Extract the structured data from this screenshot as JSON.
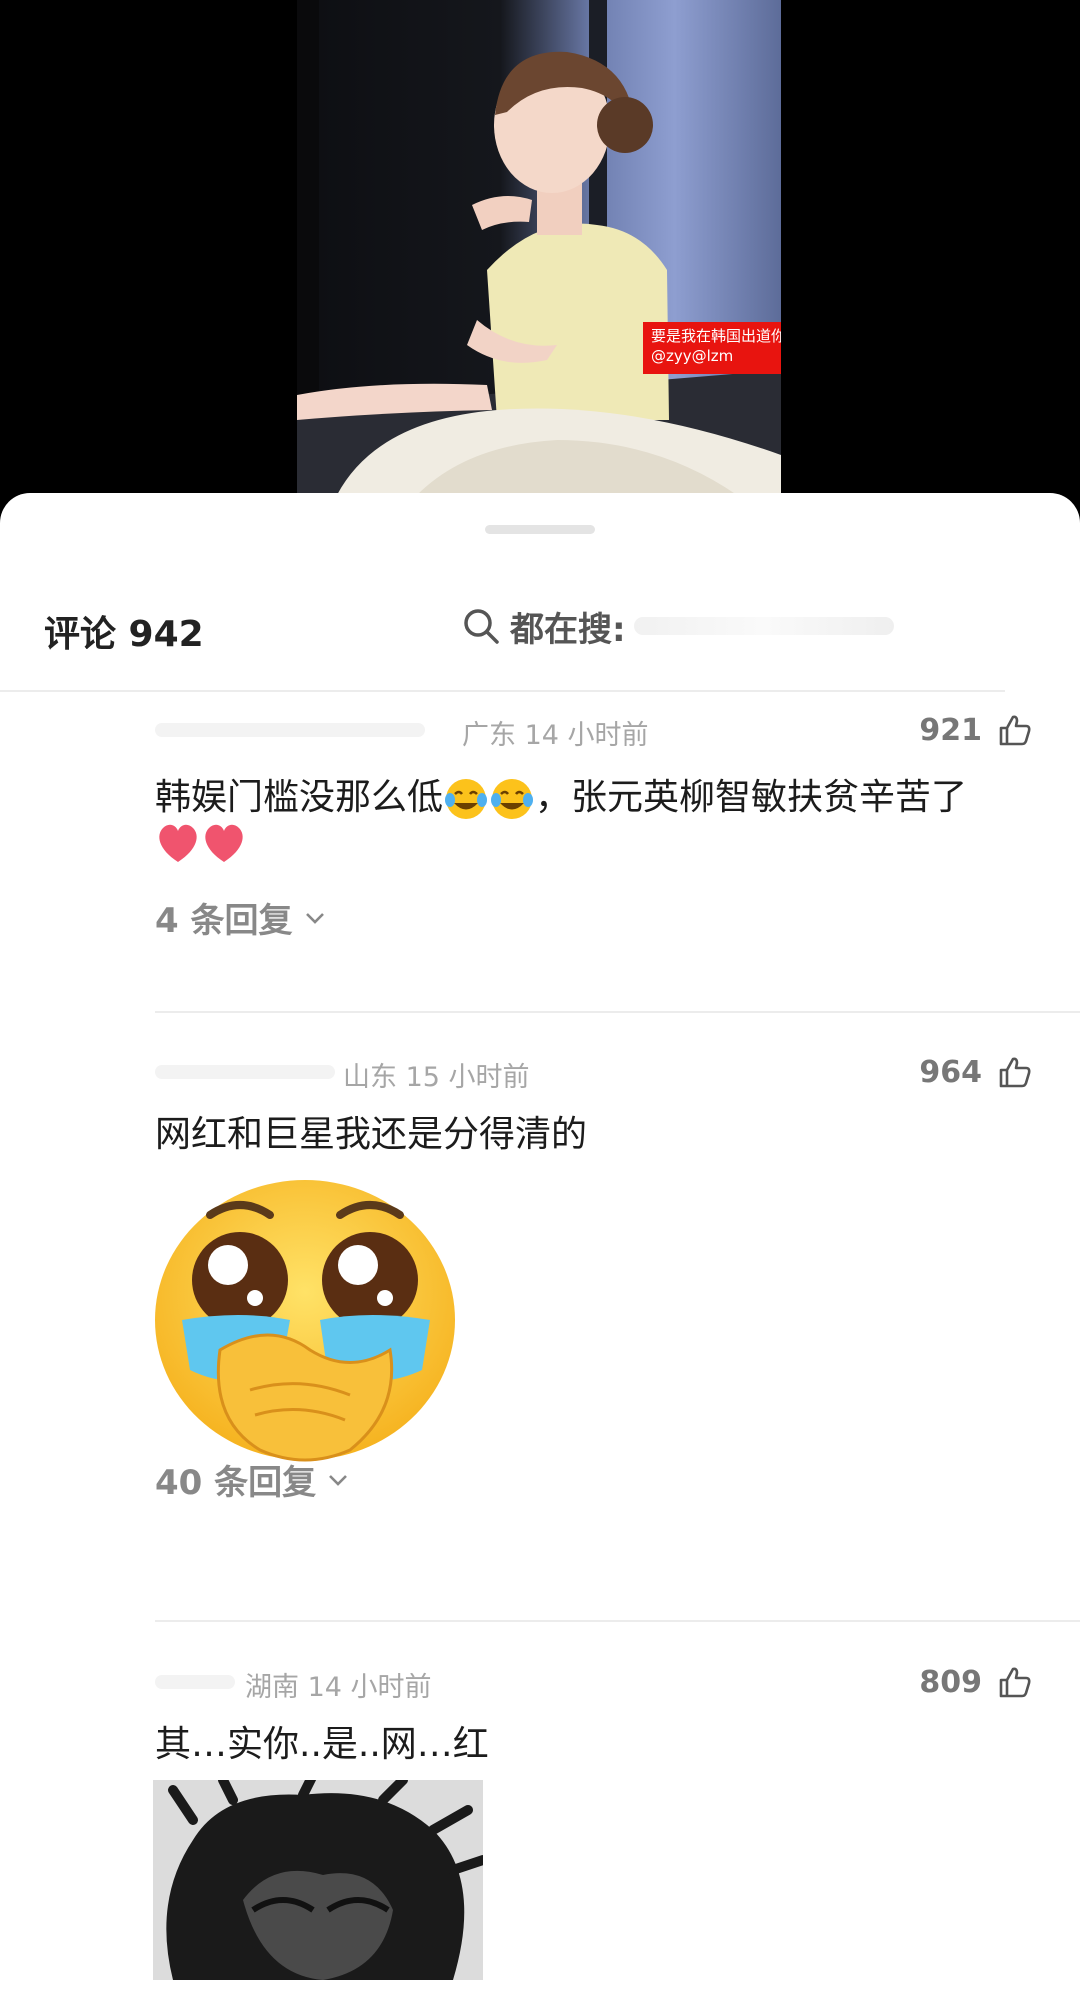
{
  "video": {
    "caption_line1": "要是我在韩国出道你不炸了",
    "caption_line2": "@zyy@lzm"
  },
  "comments_header": {
    "title": "评论 942",
    "search_label": "都在搜:"
  },
  "comments": [
    {
      "location_time": "广东 14 小时前",
      "likes": "921",
      "text_part1": "韩娱门槛没那么低",
      "text_part2": "，张元英柳智敏扶贫辛苦了",
      "replies": "4 条回复"
    },
    {
      "location_time": "山东 15 小时前",
      "likes": "964",
      "text": "网红和巨星我还是分得清的",
      "replies": "40 条回复"
    },
    {
      "location_time": "湖南 14 小时前",
      "likes": "809",
      "text": "其…实你..是..网…红"
    }
  ],
  "icons": [
    "search-icon",
    "thumbs-up-icon",
    "chevron-down-icon",
    "tears-of-joy-emoji",
    "red-heart-emoji",
    "crying-pleading-emoji"
  ]
}
